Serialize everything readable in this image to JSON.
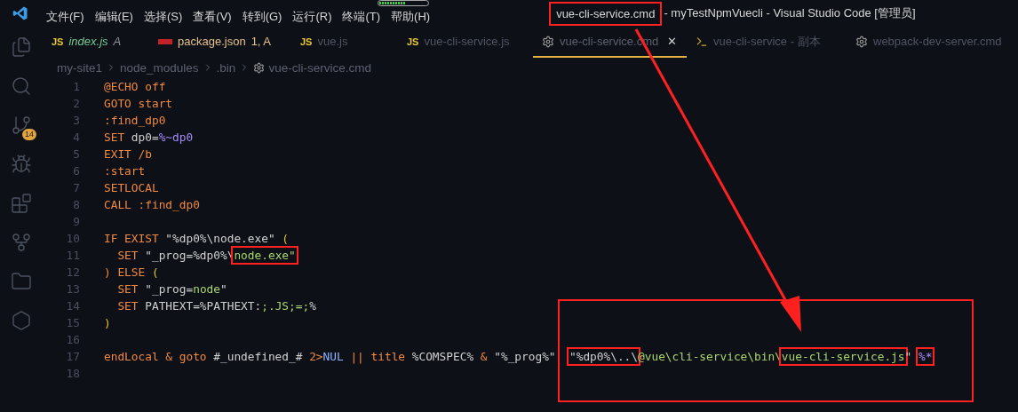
{
  "menu": [
    "文件(F)",
    "编辑(E)",
    "选择(S)",
    "查看(V)",
    "转到(G)",
    "运行(R)",
    "终端(T)",
    "帮助(H)"
  ],
  "progress": {
    "level": 0.55
  },
  "window_title": {
    "file": "vue-cli-service.cmd",
    "rest": "- myTestNpmVuecli - Visual Studio Code [管理员]",
    "boxed": true
  },
  "activity_bar": [
    {
      "kind": "files",
      "selected": false
    },
    {
      "kind": "search",
      "selected": false
    },
    {
      "kind": "scm",
      "selected": false,
      "badge": "14"
    },
    {
      "kind": "debug",
      "selected": false
    },
    {
      "kind": "extensions",
      "selected": false
    },
    {
      "kind": "git",
      "selected": false
    },
    {
      "kind": "folder",
      "selected": false
    },
    {
      "kind": "hexagon",
      "selected": false
    }
  ],
  "tabs": [
    {
      "kind": "js",
      "icon_text": "JS",
      "label": "index.js",
      "decoration": "A",
      "color": "#73c991",
      "preview": true,
      "selected": false
    },
    {
      "kind": "npm",
      "label": "package.json",
      "decoration": "1, A",
      "color": "#e2c08d",
      "preview": false,
      "selected": false
    },
    {
      "kind": "js",
      "icon_text": "JS",
      "label": "vue.js",
      "color": "#4e5563",
      "preview": false,
      "selected": false
    },
    {
      "kind": "js",
      "icon_text": "JS",
      "label": "vue-cli-service.js",
      "color": "#4e5563",
      "preview": false,
      "selected": false
    },
    {
      "kind": "gear",
      "label": "vue-cli-service.cmd",
      "color": "#5b6170",
      "preview": false,
      "selected": true,
      "close": "✕"
    },
    {
      "kind": "terminal",
      "label": "vue-cli-service - 副本",
      "color": "#4e5563",
      "preview": false,
      "selected": false
    },
    {
      "kind": "gear",
      "label": "webpack-dev-server.cmd",
      "color": "#4e5563",
      "preview": false,
      "selected": false
    }
  ],
  "breadcrumb": [
    "my-site1",
    "node_modules",
    ".bin",
    "vue-cli-service.cmd"
  ],
  "code": [
    {
      "n": "1",
      "segments": [
        {
          "t": "@ECHO off",
          "kind": "kw"
        }
      ]
    },
    {
      "n": "2",
      "segments": [
        {
          "t": "GOTO start",
          "kind": "kw"
        }
      ]
    },
    {
      "n": "3",
      "segments": [
        {
          "t": ":find_dp0",
          "kind": "kw"
        }
      ]
    },
    {
      "n": "4",
      "segments": [
        {
          "t": "SET ",
          "kind": "kw"
        },
        {
          "t": "dp0=",
          "kind": "plain"
        },
        {
          "t": "%~dp0",
          "kind": "var"
        }
      ]
    },
    {
      "n": "5",
      "segments": [
        {
          "t": "EXIT /b",
          "kind": "kw"
        }
      ]
    },
    {
      "n": "6",
      "segments": [
        {
          "t": ":start",
          "kind": "kw"
        }
      ]
    },
    {
      "n": "7",
      "segments": [
        {
          "t": "SETLOCAL",
          "kind": "kw"
        }
      ]
    },
    {
      "n": "8",
      "segments": [
        {
          "t": "CALL :find_dp0",
          "kind": "kw"
        }
      ]
    },
    {
      "n": "9"
    },
    {
      "n": "10",
      "segments": [
        {
          "t": "IF EXIST ",
          "kind": "kw"
        },
        {
          "t": "\"%dp0%\\node.exe\" ",
          "kind": "plain"
        },
        {
          "t": "(",
          "kind": "bracket"
        }
      ]
    },
    {
      "n": "11",
      "segments": [
        {
          "t": "  SET ",
          "kind": "kw"
        },
        {
          "t": "\"_prog=%dp0%\\",
          "kind": "plain"
        },
        {
          "t": "node.exe\"",
          "kind": "str",
          "boxed": true
        }
      ]
    },
    {
      "n": "12",
      "segments": [
        {
          "t": ") ELSE ",
          "kind": "kw"
        },
        {
          "t": "(",
          "kind": "bracket"
        }
      ]
    },
    {
      "n": "13",
      "segments": [
        {
          "t": "  SET ",
          "kind": "kw"
        },
        {
          "t": "\"_prog=",
          "kind": "plain"
        },
        {
          "t": "node",
          "kind": "str"
        },
        {
          "t": "\"",
          "kind": "plain"
        }
      ]
    },
    {
      "n": "14",
      "segments": [
        {
          "t": "  SET ",
          "kind": "kw"
        },
        {
          "t": "PATHEXT=%PATHEXT:",
          "kind": "plain"
        },
        {
          "t": ";.JS;=;",
          "kind": "str"
        },
        {
          "t": "%",
          "kind": "plain"
        }
      ]
    },
    {
      "n": "15",
      "segments": [
        {
          "t": ")",
          "kind": "bracket"
        }
      ]
    },
    {
      "n": "16"
    },
    {
      "n": "17",
      "segments": [
        {
          "t": "endLocal & goto ",
          "kind": "kw"
        },
        {
          "t": "#_undefined_# ",
          "kind": "plain"
        },
        {
          "t": "2>",
          "kind": "kw"
        },
        {
          "t": "NUL ",
          "kind": "const"
        },
        {
          "t": "|| title ",
          "kind": "kw"
        },
        {
          "t": "%COMSPEC% ",
          "kind": "plain"
        },
        {
          "t": "& ",
          "kind": "kw"
        },
        {
          "t": "\"%_prog%\"  ",
          "kind": "plain"
        },
        {
          "t": "\"%dp0%\\..\\",
          "kind": "plain",
          "boxed": true
        },
        {
          "t": "@vue\\cli-service\\bin\\",
          "kind": "str"
        },
        {
          "t": "vue-cli-service.js",
          "kind": "str",
          "boxed": true
        },
        {
          "t": "\" ",
          "kind": "plain"
        },
        {
          "t": "%*",
          "kind": "var",
          "boxed": true
        }
      ]
    },
    {
      "n": "18"
    }
  ]
}
